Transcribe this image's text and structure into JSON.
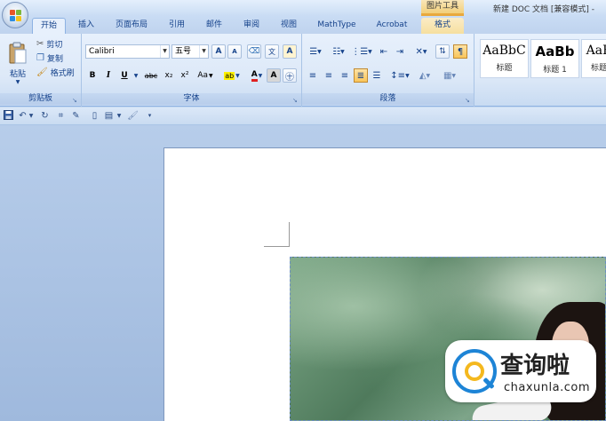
{
  "titlebar": {
    "contextual_group": "图片工具",
    "window_title": "新建 DOC 文档 [兼容模式] -"
  },
  "tabs": [
    {
      "label": "开始",
      "active": true
    },
    {
      "label": "插入"
    },
    {
      "label": "页面布局"
    },
    {
      "label": "引用"
    },
    {
      "label": "邮件"
    },
    {
      "label": "审阅"
    },
    {
      "label": "视图"
    },
    {
      "label": "MathType"
    },
    {
      "label": "Acrobat"
    },
    {
      "label": "格式",
      "contextual": true
    }
  ],
  "clipboard": {
    "paste_label": "粘贴",
    "cut_label": "剪切",
    "copy_label": "复制",
    "format_painter_label": "格式刷",
    "group_label": "剪贴板"
  },
  "font": {
    "font_name": "Calibri",
    "font_size": "五号",
    "grow_label": "A",
    "shrink_label": "A",
    "bold": "B",
    "italic": "I",
    "underline": "U",
    "strike": "abc",
    "subscript": "x₂",
    "superscript": "x²",
    "change_case": "Aa",
    "font_color": "A",
    "char_shading": "A",
    "group_label": "字体"
  },
  "paragraph": {
    "group_label": "段落"
  },
  "styles": {
    "items": [
      {
        "sample": "AaBbC",
        "name": "标题"
      },
      {
        "sample": "AaBb",
        "name": "标题 1"
      },
      {
        "sample": "AaB",
        "name": "标题"
      }
    ]
  },
  "watermark": {
    "text": "查询啦",
    "domain": "chaxunla.com"
  },
  "colors": {
    "accent": "#15428b",
    "highlight": "#f9c55a",
    "logo_blue": "#1d84d6",
    "logo_yellow": "#f4b81e"
  }
}
